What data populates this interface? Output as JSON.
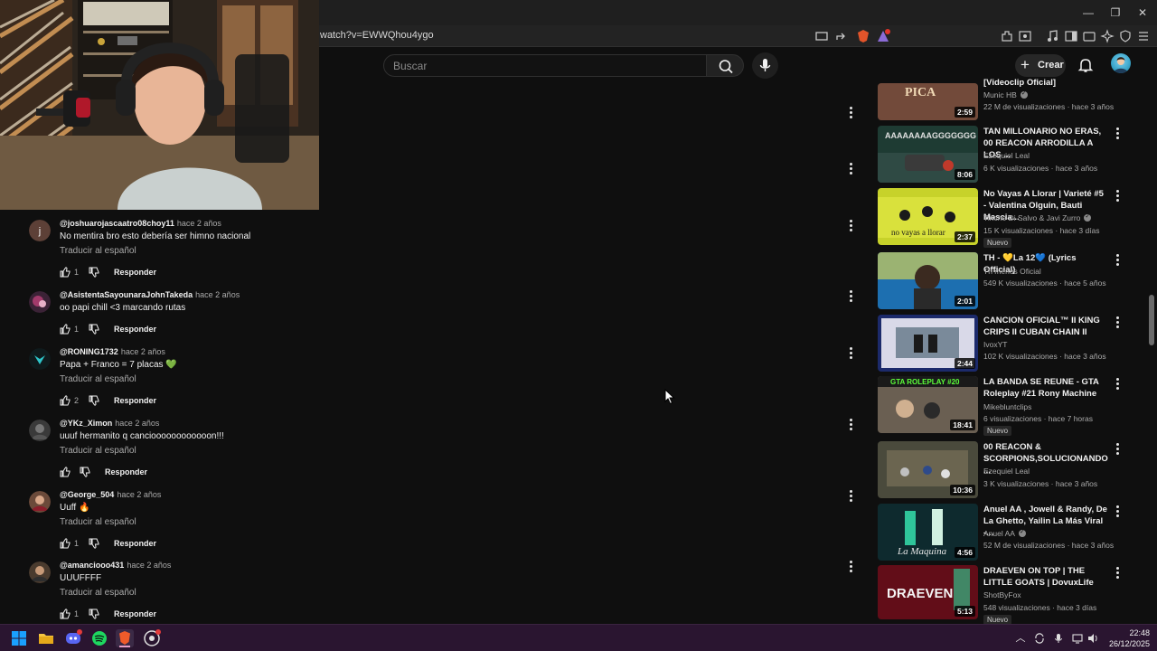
{
  "browser": {
    "url": "watch?v=EWWQhou4ygo",
    "window_controls": {
      "minimize": "—",
      "restore": "❐",
      "close": "✕"
    }
  },
  "header": {
    "search_placeholder": "Buscar",
    "create_label": "Crear"
  },
  "comments": [
    {
      "handle": "@joshuarojascaatro08choy11",
      "time": "hace 2 años",
      "text": "No mentira bro esto debería ser himno nacional",
      "translate": "Traducir al español",
      "likes": "1",
      "reply": "Responder"
    },
    {
      "handle": "@AsistentaSayounaraJohnTakeda",
      "time": "hace 2 años",
      "text": "oo papi chill <3 marcando rutas",
      "translate": "",
      "likes": "1",
      "reply": "Responder"
    },
    {
      "handle": "@RONING1732",
      "time": "hace 2 años",
      "text": "Papa + Franco = 7 placas 💚",
      "translate": "Traducir al español",
      "likes": "2",
      "reply": "Responder"
    },
    {
      "handle": "@YKz_Ximon",
      "time": "hace 2 años",
      "text": "uuuf hermanito q cancioooooooooooon!!!",
      "translate": "Traducir al español",
      "likes": "",
      "reply": "Responder"
    },
    {
      "handle": "@George_504",
      "time": "hace 2 años",
      "text": "Uuff 🔥",
      "translate": "Traducir al español",
      "likes": "1",
      "reply": "Responder"
    },
    {
      "handle": "@amanciooo431",
      "time": "hace 2 años",
      "text": "UUUFFFF",
      "translate": "Traducir al español",
      "likes": "1",
      "reply": "Responder"
    }
  ],
  "sidebar": [
    {
      "title": "[Videoclip Oficial]",
      "channel": "Munic HB",
      "verified": true,
      "meta": "22 M de visualizaciones · hace 3 años",
      "duration": "2:59",
      "badge": ""
    },
    {
      "title": "TAN MILLONARIO NO ERAS, 00 REACON ARRODILLA A LOS ...",
      "channel": "Ezequiel Leal",
      "verified": false,
      "meta": "6 K visualizaciones · hace 3 años",
      "duration": "8:06",
      "badge": ""
    },
    {
      "title": "No Vayas A Llorar | Varieté #5 - Valentina Olguin, Bauti Mascia...",
      "channel": "Tincho Di Salvo & Javi Zurro",
      "verified": true,
      "meta": "15 K visualizaciones · hace 3 días",
      "duration": "2:37",
      "badge": "Nuevo"
    },
    {
      "title": "TH - 💛La 12💙 (Lyrics Official)",
      "channel": "Th menos Oficial",
      "verified": false,
      "meta": "549 K visualizaciones · hace 5 años",
      "duration": "2:01",
      "badge": ""
    },
    {
      "title": "CANCION OFICIAL™ II KING CRIPS II CUBAN CHAIN II",
      "channel": "IvoxYT",
      "verified": false,
      "meta": "102 K visualizaciones · hace 3 años",
      "duration": "2:44",
      "badge": ""
    },
    {
      "title": "LA BANDA SE REUNE - GTA Roleplay #21 Rony Machine",
      "channel": "Mikebluntclips",
      "verified": false,
      "meta": "6 visualizaciones · hace 7 horas",
      "duration": "18:41",
      "badge": "Nuevo"
    },
    {
      "title": "00 REACON & SCORPIONS,SOLUCIONANDO ...",
      "channel": "Ezequiel Leal",
      "verified": false,
      "meta": "3 K visualizaciones · hace 3 años",
      "duration": "10:36",
      "badge": ""
    },
    {
      "title": "Anuel AA , Jowell & Randy, De La Ghetto, Yailin La Más Viral -...",
      "channel": "Anuel AA",
      "verified": true,
      "meta": "52 M de visualizaciones · hace 3 años",
      "duration": "4:56",
      "badge": ""
    },
    {
      "title": "DRAEVEN ON TOP | THE LITTLE GOATS | DovuxLife",
      "channel": "ShotByFox",
      "verified": false,
      "meta": "548 visualizaciones · hace 3 días",
      "duration": "5:13",
      "badge": "Nuevo"
    }
  ],
  "taskbar": {
    "time": "22:48",
    "date": "26/12/2025"
  }
}
